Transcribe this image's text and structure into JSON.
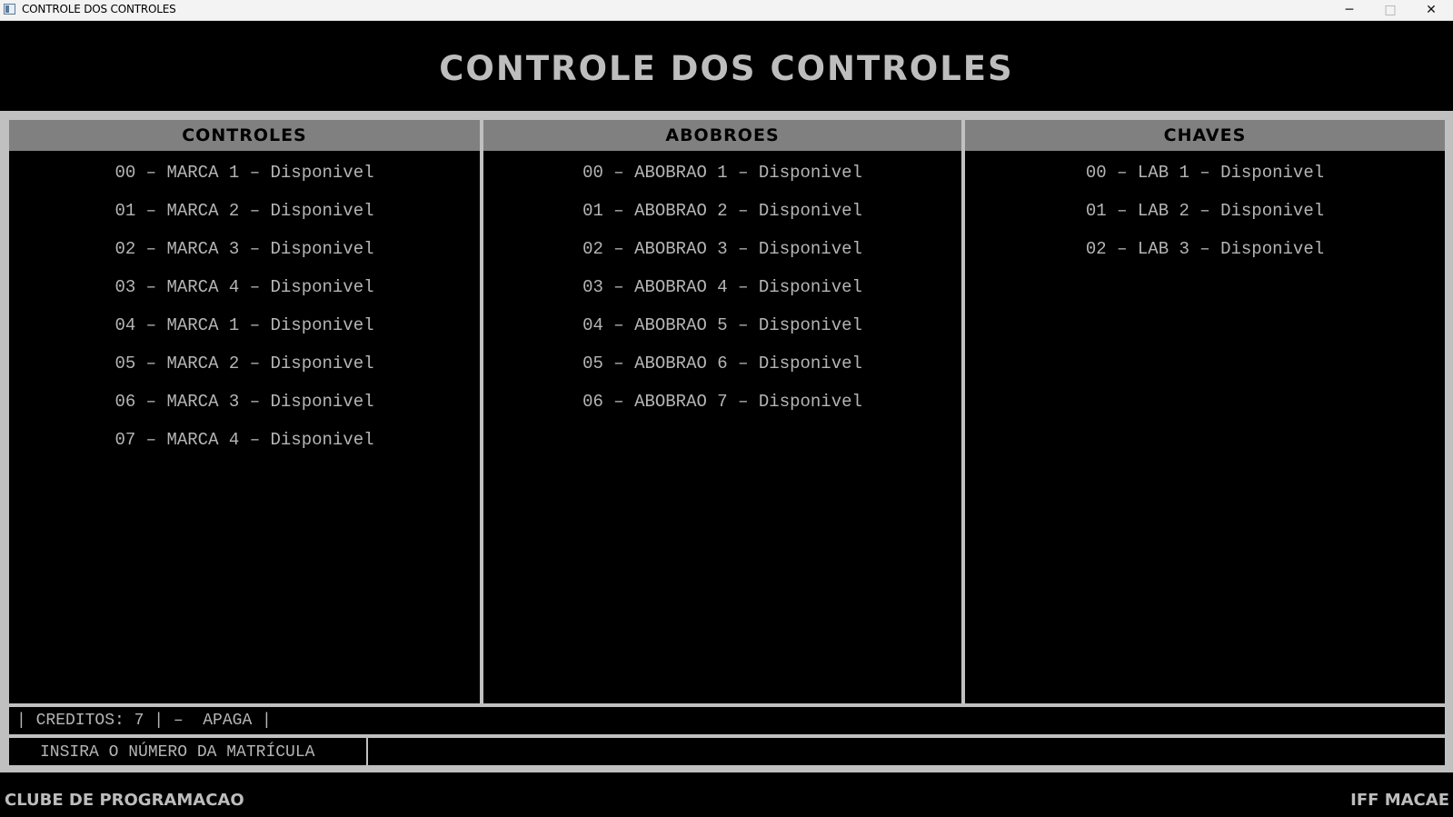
{
  "window": {
    "title": "CONTROLE DOS CONTROLES",
    "icon": "app-window-icon",
    "minimize_glyph": "─",
    "maximize_glyph": "□",
    "close_glyph": "✕"
  },
  "header": {
    "title": "CONTROLE DOS CONTROLES"
  },
  "columns": [
    {
      "title": "CONTROLES",
      "items": [
        "00 – MARCA 1 – Disponivel",
        "01 – MARCA 2 – Disponivel",
        "02 – MARCA 3 – Disponivel",
        "03 – MARCA 4 – Disponivel",
        "04 – MARCA 1 – Disponivel",
        "05 – MARCA 2 – Disponivel",
        "06 – MARCA 3 – Disponivel",
        "07 – MARCA 4 – Disponivel"
      ]
    },
    {
      "title": "ABOBROES",
      "items": [
        "00 – ABOBRAO 1 – Disponivel",
        "01 – ABOBRAO 2 – Disponivel",
        "02 – ABOBRAO 3 – Disponivel",
        "03 – ABOBRAO 4 – Disponivel",
        "04 – ABOBRAO 5 – Disponivel",
        "05 – ABOBRAO 6 – Disponivel",
        "06 – ABOBRAO 7 – Disponivel"
      ]
    },
    {
      "title": "CHAVES",
      "items": [
        "00 – LAB 1 – Disponivel",
        "01 – LAB 2 – Disponivel",
        "02 – LAB 3 – Disponivel"
      ]
    }
  ],
  "status": {
    "text": "| CREDITOS: 7 | –  APAGA |"
  },
  "input": {
    "label": "INSIRA O NÚMERO DA MATRÍCULA",
    "value": ""
  },
  "footer": {
    "left": "CLUBE DE PROGRAMACAO",
    "right": "IFF MACAE"
  },
  "colors": {
    "background": "#000000",
    "frame": "#c0c0c0",
    "column_header": "#808080",
    "text": "#b5b5b5"
  }
}
